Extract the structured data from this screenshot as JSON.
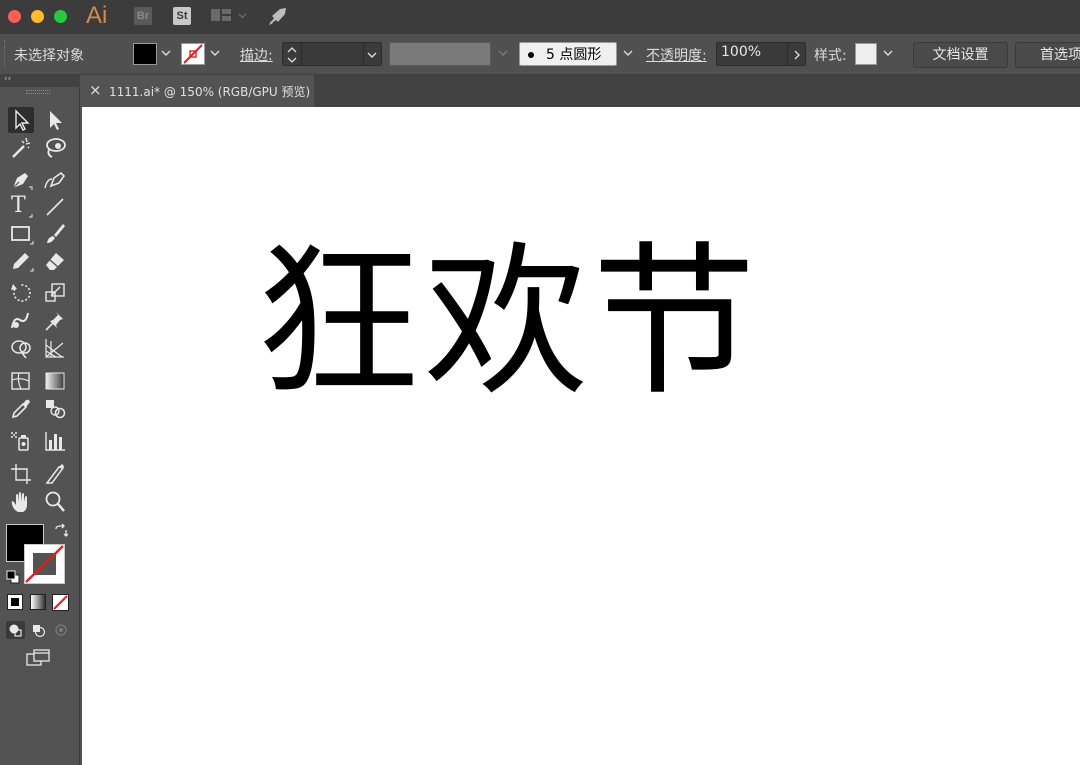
{
  "window": {
    "app_logo": "Ai",
    "bridge_label": "Br",
    "stock_label": "St",
    "traffic_light_colors": [
      "#fd5f57",
      "#febc2e",
      "#28c840"
    ]
  },
  "control_bar": {
    "selection_status": "未选择对象",
    "stroke_label": "描边:",
    "brush_profile": "5 点圆形",
    "opacity_label": "不透明度:",
    "opacity_value": "100%",
    "style_label": "样式:",
    "document_setup_label": "文档设置",
    "preferences_label": "首选项",
    "fill_color": "#000000",
    "stroke_color": "none"
  },
  "document_tab": {
    "title": "1111.ai* @ 150% (RGB/GPU 预览)",
    "close_glyph": "×"
  },
  "tools": {
    "collapse_glyph": "‹‹",
    "items": [
      "selection-tool",
      "direct-selection-tool",
      "magic-wand-tool",
      "lasso-tool",
      "pen-tool",
      "curvature-tool",
      "type-tool",
      "line-segment-tool",
      "rectangle-tool",
      "paintbrush-tool",
      "pencil-tool",
      "eraser-tool",
      "rotate-tool",
      "scale-tool",
      "warp-tool",
      "puppet-warp-tool",
      "shape-builder-tool",
      "perspective-grid-tool",
      "mesh-tool",
      "gradient-tool",
      "eyedropper-tool",
      "blend-tool",
      "symbol-sprayer-tool",
      "column-graph-tool",
      "artboard-tool",
      "slice-tool",
      "hand-tool",
      "zoom-tool"
    ],
    "type_glyph": "T"
  },
  "canvas": {
    "artwork_text": "狂欢节",
    "artwork_color": "#000000"
  }
}
